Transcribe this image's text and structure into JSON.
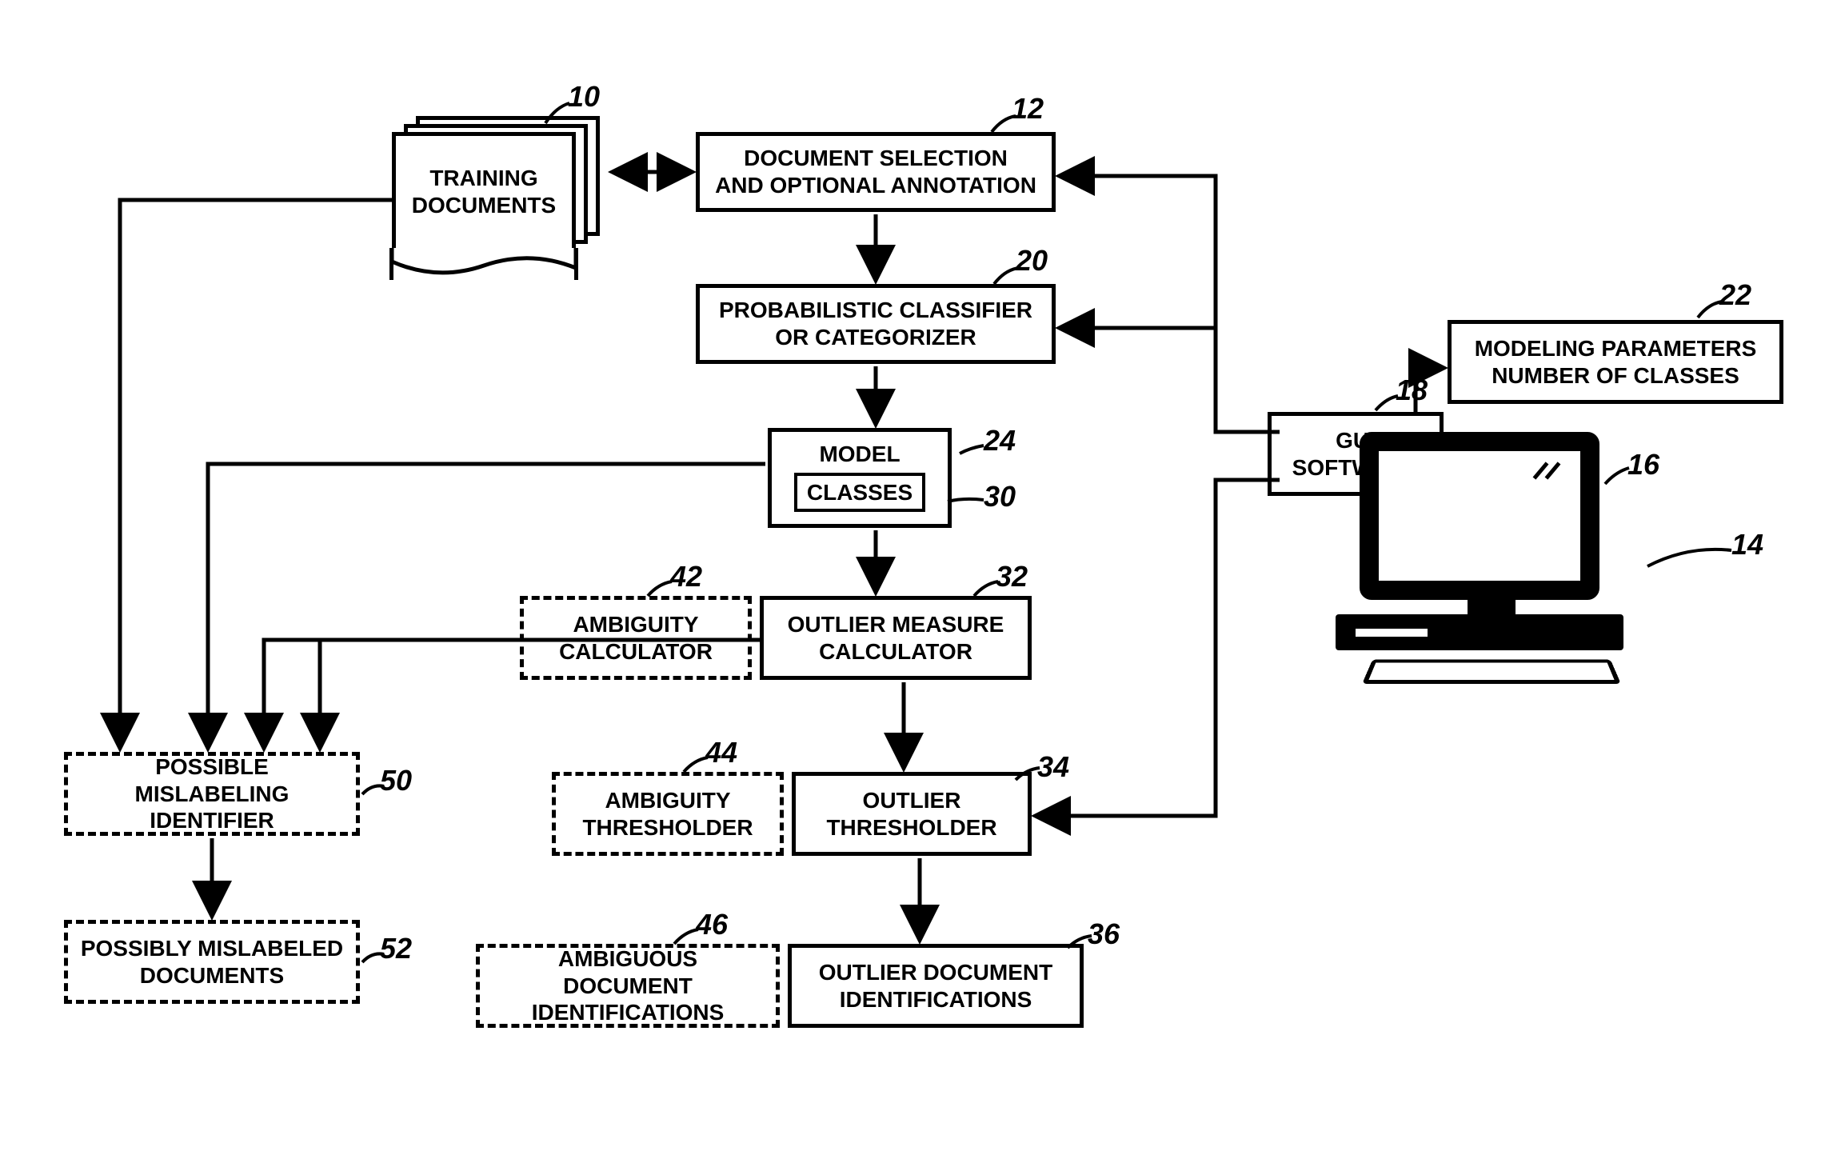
{
  "nodes": {
    "training_docs": {
      "label": "TRAINING\nDOCUMENTS",
      "ref": "10"
    },
    "doc_selection": {
      "label": "DOCUMENT SELECTION\nAND OPTIONAL ANNOTATION",
      "ref": "12"
    },
    "classifier": {
      "label": "PROBABILISTIC CLASSIFIER\nOR CATEGORIZER",
      "ref": "20"
    },
    "model": {
      "label": "MODEL",
      "inner": "CLASSES",
      "ref": "24",
      "inner_ref": "30"
    },
    "outlier_calc": {
      "label": "OUTLIER MEASURE\nCALCULATOR",
      "ref": "32"
    },
    "outlier_thresh": {
      "label": "OUTLIER\nTHRESHOLDER",
      "ref": "34"
    },
    "outlier_ids": {
      "label": "OUTLIER DOCUMENT\nIDENTIFICATIONS",
      "ref": "36"
    },
    "amb_calc": {
      "label": "AMBIGUITY\nCALCULATOR",
      "ref": "42"
    },
    "amb_thresh": {
      "label": "AMBIGUITY\nTHRESHOLDER",
      "ref": "44"
    },
    "amb_ids": {
      "label": "AMBIGUOUS DOCUMENT\nIDENTIFICATIONS",
      "ref": "46"
    },
    "mislabel_id": {
      "label": "POSSIBLE MISLABELING\nIDENTIFIER",
      "ref": "50"
    },
    "mislabel_docs": {
      "label": "POSSIBLY MISLABELED\nDOCUMENTS",
      "ref": "52"
    },
    "gui": {
      "label": "GUI\nSOFTWARE",
      "ref": "18"
    },
    "modeling": {
      "label": "MODELING PARAMETERS\nNUMBER OF CLASSES",
      "ref": "22"
    },
    "computer": {
      "ref": "16"
    },
    "system": {
      "ref": "14"
    }
  }
}
